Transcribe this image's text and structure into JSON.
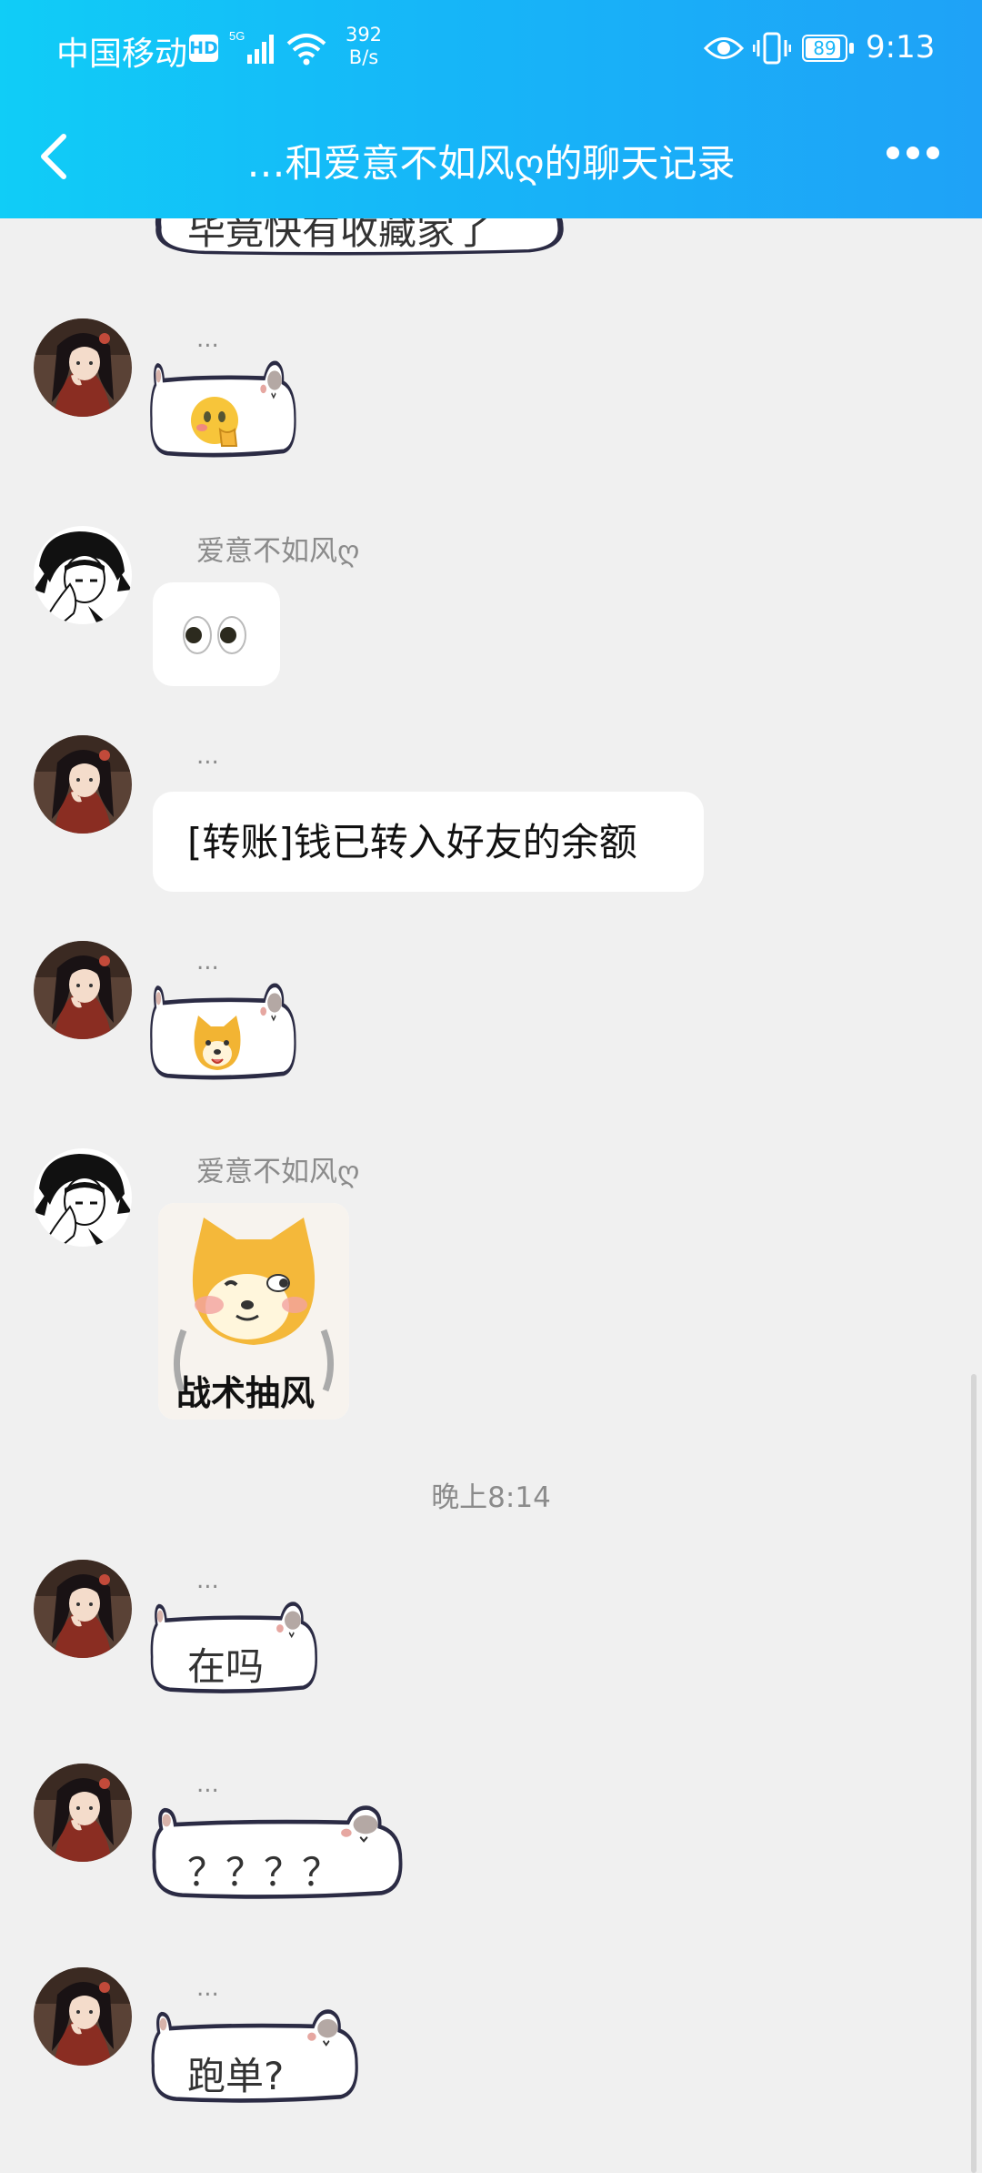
{
  "status_bar": {
    "carrier": "中国移动",
    "hd": "HD",
    "network": "5G",
    "speed_value": "392",
    "speed_unit": "B/s",
    "battery": "89",
    "time": "9:13"
  },
  "title_bar": {
    "title": "…和爱意不如风ღ的聊天记录",
    "back_icon": "chevron-left-icon",
    "more_icon": "more-dots-icon"
  },
  "messages": [
    {
      "sender": "",
      "type": "cat-bubble",
      "text": "毕竟快有收藏家了",
      "partial": true
    },
    {
      "sender": "...",
      "type": "cat-bubble",
      "text": "",
      "emoji": "emoji-face-hand-icon"
    },
    {
      "sender": "爱意不如风ღ",
      "type": "emoji",
      "emoji": "eyes-emoji-icon"
    },
    {
      "sender": "...",
      "type": "text",
      "text": "[转账]钱已转入好友的余额"
    },
    {
      "sender": "...",
      "type": "cat-bubble",
      "text": "",
      "emoji": "shiba-emoji-icon"
    },
    {
      "sender": "爱意不如风ღ",
      "type": "sticker",
      "sticker_caption": "战术抽风"
    },
    {
      "type": "timestamp",
      "text": "晚上8:14"
    },
    {
      "sender": "...",
      "type": "cat-bubble",
      "text": "在吗"
    },
    {
      "sender": "...",
      "type": "cat-bubble",
      "text": "？？？？"
    },
    {
      "sender": "...",
      "type": "cat-bubble",
      "text": "跑单?"
    }
  ],
  "colors": {
    "header_gradient_start": "#10cdf7",
    "header_gradient_end": "#1fa2f7",
    "background": "#f0f0f0",
    "nickname": "#8b8b8b",
    "cat_outline": "#2b2b44"
  }
}
